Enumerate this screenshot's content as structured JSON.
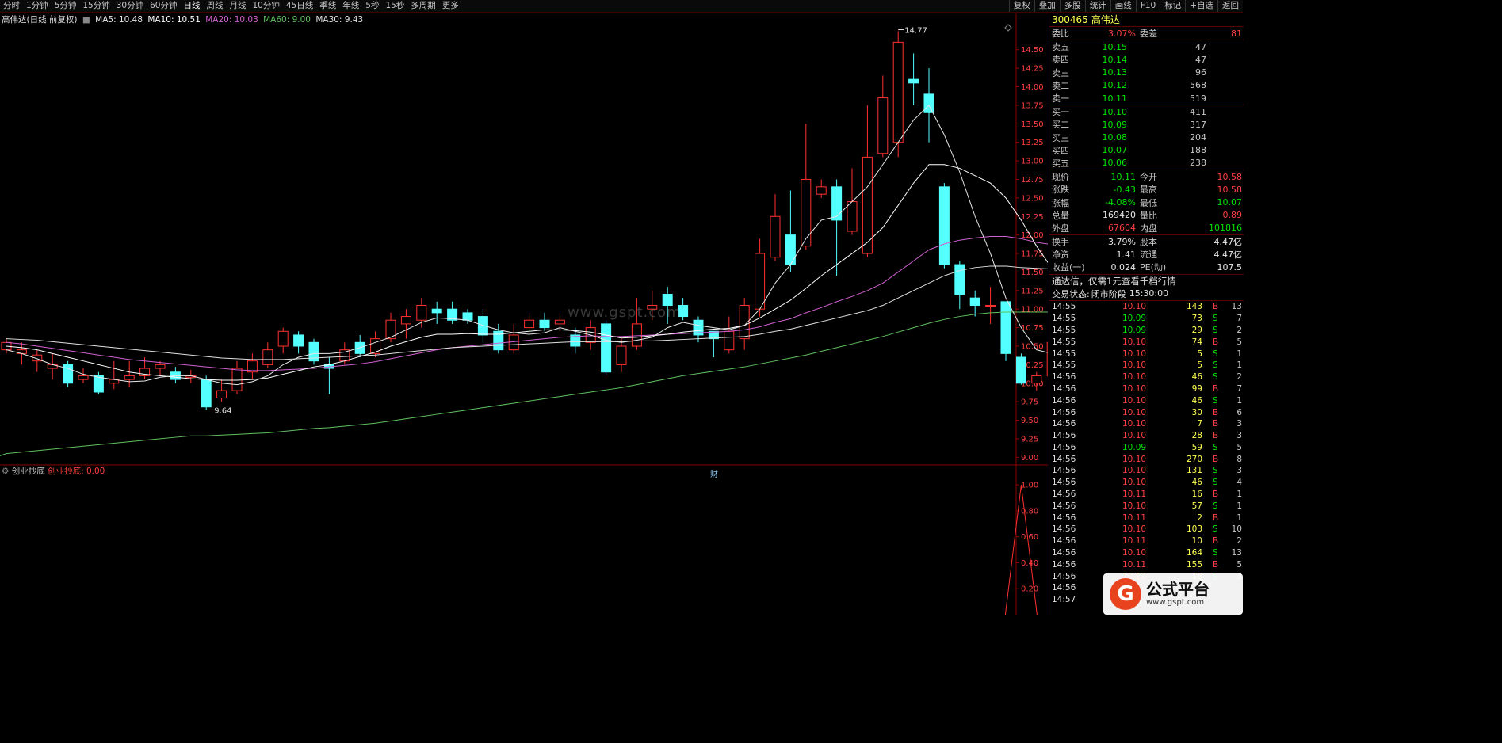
{
  "toolbar": {
    "periods": [
      "分时",
      "1分钟",
      "5分钟",
      "15分钟",
      "30分钟",
      "60分钟",
      "日线",
      "周线",
      "月线",
      "10分钟",
      "45日线",
      "季线",
      "年线",
      "5秒",
      "15秒",
      "多周期",
      "更多"
    ],
    "active_period": "日线",
    "tools": [
      "复权",
      "叠加",
      "多股",
      "统计",
      "画线",
      "F10",
      "标记",
      "+自选",
      "返回"
    ]
  },
  "legend": {
    "name": "高伟达(日线 前复权)",
    "ma5": "MA5: 10.48",
    "ma10": "MA10: 10.51",
    "ma20": "MA20: 10.03",
    "ma60": "MA60: 9.00",
    "ma30": "MA30: 9.43"
  },
  "indicator": {
    "name": "创业抄底",
    "value": "创业抄底: 0.00"
  },
  "watermark": "www.gspt.com",
  "marker_cai": "财",
  "colors": {
    "up": "#ff3030",
    "down": "#54ffff",
    "ma5": "#e8e8e8",
    "ma10": "#ffffff",
    "ma20": "#d060d0",
    "ma30": "#e0e0e0",
    "ma60": "#60c060"
  },
  "chart_data": {
    "type": "candlestick",
    "ylim": [
      8.95,
      14.85
    ],
    "yticks": [
      "14.50",
      "14.25",
      "14.00",
      "13.75",
      "13.50",
      "13.25",
      "13.00",
      "12.75",
      "12.50",
      "12.25",
      "12.00",
      "11.75",
      "11.50",
      "11.25",
      "11.00",
      "10.75",
      "10.50",
      "10.25",
      "10.00",
      "9.75",
      "9.50",
      "9.25",
      "9.00"
    ],
    "annotations": [
      "14.77",
      "9.64"
    ],
    "candles": [
      [
        10.45,
        10.55,
        10.4,
        10.6
      ],
      [
        10.4,
        10.45,
        10.25,
        10.55
      ],
      [
        10.3,
        10.38,
        10.15,
        10.45
      ],
      [
        10.2,
        10.25,
        10.05,
        10.4
      ],
      [
        10.25,
        10.0,
        9.95,
        10.3
      ],
      [
        10.05,
        10.1,
        10.0,
        10.2
      ],
      [
        10.1,
        9.88,
        9.85,
        10.15
      ],
      [
        10.0,
        10.05,
        9.92,
        10.3
      ],
      [
        10.05,
        10.1,
        9.95,
        10.3
      ],
      [
        10.1,
        10.2,
        10.05,
        10.35
      ],
      [
        10.2,
        10.25,
        10.1,
        10.3
      ],
      [
        10.15,
        10.05,
        10.0,
        10.22
      ],
      [
        10.08,
        10.1,
        10.0,
        10.18
      ],
      [
        10.05,
        9.68,
        9.64,
        10.1
      ],
      [
        9.8,
        9.9,
        9.75,
        10.05
      ],
      [
        9.9,
        10.2,
        9.85,
        10.3
      ],
      [
        10.15,
        10.3,
        10.05,
        10.4
      ],
      [
        10.25,
        10.45,
        10.2,
        10.55
      ],
      [
        10.5,
        10.7,
        10.4,
        10.75
      ],
      [
        10.65,
        10.5,
        10.4,
        10.7
      ],
      [
        10.55,
        10.3,
        10.25,
        10.6
      ],
      [
        10.25,
        10.2,
        9.85,
        10.35
      ],
      [
        10.3,
        10.45,
        10.25,
        10.55
      ],
      [
        10.55,
        10.4,
        10.35,
        10.65
      ],
      [
        10.4,
        10.6,
        10.35,
        10.7
      ],
      [
        10.6,
        10.85,
        10.55,
        10.95
      ],
      [
        10.8,
        10.9,
        10.6,
        11.0
      ],
      [
        10.85,
        11.05,
        10.75,
        11.15
      ],
      [
        11.0,
        10.95,
        10.8,
        11.1
      ],
      [
        11.0,
        10.85,
        10.8,
        11.1
      ],
      [
        10.95,
        10.85,
        10.8,
        11.0
      ],
      [
        10.9,
        10.65,
        10.55,
        11.0
      ],
      [
        10.7,
        10.45,
        10.4,
        10.8
      ],
      [
        10.45,
        10.65,
        10.4,
        10.8
      ],
      [
        10.75,
        10.85,
        10.7,
        10.95
      ],
      [
        10.85,
        10.75,
        10.7,
        10.95
      ],
      [
        10.8,
        10.85,
        10.7,
        10.95
      ],
      [
        10.65,
        10.5,
        10.4,
        10.75
      ],
      [
        10.55,
        10.75,
        10.45,
        10.85
      ],
      [
        10.8,
        10.15,
        10.1,
        10.85
      ],
      [
        10.25,
        10.5,
        10.15,
        10.6
      ],
      [
        10.5,
        10.8,
        10.45,
        11.15
      ],
      [
        11.0,
        11.05,
        10.85,
        11.25
      ],
      [
        11.2,
        11.05,
        10.8,
        11.3
      ],
      [
        11.05,
        10.9,
        10.85,
        11.15
      ],
      [
        10.85,
        10.65,
        10.55,
        10.9
      ],
      [
        10.7,
        10.6,
        10.35,
        10.7
      ],
      [
        10.45,
        10.7,
        10.4,
        10.9
      ],
      [
        10.6,
        11.05,
        10.45,
        11.15
      ],
      [
        11.0,
        11.75,
        10.9,
        11.95
      ],
      [
        11.7,
        12.25,
        11.65,
        12.55
      ],
      [
        12.0,
        11.6,
        11.5,
        12.6
      ],
      [
        11.85,
        12.75,
        11.8,
        13.5
      ],
      [
        12.55,
        12.65,
        12.5,
        12.75
      ],
      [
        12.65,
        12.2,
        11.45,
        12.75
      ],
      [
        12.05,
        12.45,
        12.0,
        12.9
      ],
      [
        11.75,
        13.05,
        11.7,
        13.75
      ],
      [
        13.1,
        13.85,
        13.05,
        14.15
      ],
      [
        13.25,
        14.6,
        13.05,
        14.75
      ],
      [
        14.1,
        14.05,
        13.75,
        14.45
      ],
      [
        13.9,
        13.65,
        13.25,
        14.25
      ],
      [
        12.65,
        11.6,
        11.55,
        12.7
      ],
      [
        11.6,
        11.2,
        11.0,
        11.65
      ],
      [
        11.15,
        11.05,
        10.9,
        11.25
      ],
      [
        11.05,
        11.05,
        10.8,
        11.3
      ],
      [
        11.1,
        10.4,
        10.3,
        11.1
      ],
      [
        10.35,
        10.0,
        9.98,
        10.4
      ],
      [
        10.0,
        10.1,
        9.9,
        10.15
      ],
      [
        10.1,
        10.55,
        10.0,
        10.6
      ],
      [
        10.55,
        10.4,
        10.38,
        10.6
      ],
      [
        10.35,
        10.55,
        10.3,
        10.65
      ],
      [
        10.6,
        10.1,
        10.08,
        10.62
      ]
    ],
    "ma5": [
      10.45,
      10.4,
      10.33,
      10.25,
      10.2,
      10.12,
      10.08,
      10.05,
      10.02,
      10.03,
      10.08,
      10.1,
      10.1,
      10.05,
      10.0,
      9.98,
      10.02,
      10.1,
      10.25,
      10.35,
      10.4,
      10.4,
      10.42,
      10.48,
      10.55,
      10.62,
      10.72,
      10.82,
      10.88,
      10.87,
      10.85,
      10.78,
      10.72,
      10.68,
      10.66,
      10.68,
      10.75,
      10.7,
      10.65,
      10.58,
      10.55,
      10.58,
      10.62,
      10.75,
      10.82,
      10.78,
      10.75,
      10.72,
      10.78,
      11.0,
      11.35,
      11.6,
      11.95,
      12.2,
      12.25,
      12.45,
      12.65,
      12.95,
      13.25,
      13.55,
      13.75,
      13.35,
      12.85,
      12.25,
      11.75,
      11.15,
      10.75,
      10.45,
      10.4,
      10.28,
      10.3,
      10.35
    ],
    "ma10": [
      10.5,
      10.48,
      10.45,
      10.4,
      10.35,
      10.3,
      10.25,
      10.2,
      10.15,
      10.12,
      10.1,
      10.08,
      10.06,
      10.05,
      10.04,
      10.04,
      10.05,
      10.07,
      10.12,
      10.17,
      10.22,
      10.25,
      10.3,
      10.36,
      10.42,
      10.5,
      10.56,
      10.62,
      10.66,
      10.66,
      10.67,
      10.66,
      10.66,
      10.68,
      10.7,
      10.72,
      10.72,
      10.71,
      10.69,
      10.65,
      10.61,
      10.62,
      10.64,
      10.66,
      10.69,
      10.71,
      10.73,
      10.74,
      10.78,
      10.88,
      11.0,
      11.12,
      11.28,
      11.45,
      11.6,
      11.75,
      11.9,
      12.1,
      12.4,
      12.7,
      12.95,
      12.95,
      12.9,
      12.8,
      12.7,
      12.5,
      12.2,
      11.85,
      11.55,
      11.25,
      10.9,
      10.7
    ],
    "ma20": [
      10.55,
      10.53,
      10.5,
      10.47,
      10.44,
      10.41,
      10.38,
      10.35,
      10.32,
      10.3,
      10.28,
      10.26,
      10.24,
      10.22,
      10.2,
      10.18,
      10.17,
      10.17,
      10.18,
      10.19,
      10.2,
      10.22,
      10.24,
      10.26,
      10.29,
      10.33,
      10.37,
      10.41,
      10.45,
      10.48,
      10.5,
      10.52,
      10.54,
      10.56,
      10.58,
      10.6,
      10.62,
      10.63,
      10.64,
      10.63,
      10.63,
      10.64,
      10.65,
      10.66,
      10.67,
      10.68,
      10.69,
      10.7,
      10.72,
      10.76,
      10.82,
      10.87,
      10.95,
      11.02,
      11.1,
      11.17,
      11.25,
      11.35,
      11.5,
      11.65,
      11.8,
      11.88,
      11.93,
      11.96,
      11.98,
      11.98,
      11.95,
      11.9,
      11.87,
      11.85,
      11.82,
      11.75
    ],
    "ma30": [
      10.6,
      10.59,
      10.58,
      10.56,
      10.54,
      10.52,
      10.5,
      10.48,
      10.46,
      10.44,
      10.42,
      10.4,
      10.38,
      10.36,
      10.34,
      10.33,
      10.32,
      10.32,
      10.32,
      10.33,
      10.34,
      10.35,
      10.36,
      10.37,
      10.38,
      10.4,
      10.42,
      10.44,
      10.46,
      10.48,
      10.49,
      10.5,
      10.51,
      10.52,
      10.53,
      10.54,
      10.55,
      10.56,
      10.56,
      10.56,
      10.56,
      10.57,
      10.57,
      10.58,
      10.59,
      10.6,
      10.61,
      10.62,
      10.63,
      10.66,
      10.7,
      10.73,
      10.78,
      10.83,
      10.88,
      10.93,
      10.98,
      11.05,
      11.15,
      11.25,
      11.35,
      11.45,
      11.52,
      11.56,
      11.58,
      11.58,
      11.56,
      11.55,
      11.54,
      11.53,
      11.52,
      11.5
    ],
    "ma60": [
      9.05,
      9.07,
      9.09,
      9.11,
      9.13,
      9.15,
      9.17,
      9.19,
      9.21,
      9.23,
      9.25,
      9.27,
      9.29,
      9.29,
      9.3,
      9.31,
      9.32,
      9.33,
      9.35,
      9.37,
      9.39,
      9.4,
      9.42,
      9.44,
      9.46,
      9.49,
      9.52,
      9.55,
      9.58,
      9.61,
      9.64,
      9.67,
      9.7,
      9.73,
      9.76,
      9.79,
      9.82,
      9.85,
      9.88,
      9.91,
      9.94,
      9.98,
      10.02,
      10.06,
      10.1,
      10.13,
      10.16,
      10.19,
      10.22,
      10.26,
      10.3,
      10.34,
      10.38,
      10.43,
      10.48,
      10.53,
      10.58,
      10.63,
      10.69,
      10.75,
      10.81,
      10.86,
      10.9,
      10.93,
      10.95,
      10.96,
      10.96,
      10.96,
      10.96,
      10.96,
      10.96,
      10.95
    ],
    "indicator": {
      "ylim": [
        0,
        1.05
      ],
      "yticks": [
        "1.00",
        "0.80",
        "0.60",
        "0.40",
        "0.20"
      ],
      "peak_index": 66,
      "peak_value": 1.0
    }
  },
  "quote": {
    "code": "300465",
    "name": "高伟达",
    "wb_label": "委比",
    "wb_value": "3.07%",
    "wc_label": "委差",
    "wc_value": "81",
    "asks": [
      {
        "label": "卖五",
        "price": "10.15",
        "vol": "47"
      },
      {
        "label": "卖四",
        "price": "10.14",
        "vol": "47"
      },
      {
        "label": "卖三",
        "price": "10.13",
        "vol": "96"
      },
      {
        "label": "卖二",
        "price": "10.12",
        "vol": "568"
      },
      {
        "label": "卖一",
        "price": "10.11",
        "vol": "519"
      }
    ],
    "bids": [
      {
        "label": "买一",
        "price": "10.10",
        "vol": "411"
      },
      {
        "label": "买二",
        "price": "10.09",
        "vol": "317"
      },
      {
        "label": "买三",
        "price": "10.08",
        "vol": "204"
      },
      {
        "label": "买四",
        "price": "10.07",
        "vol": "188"
      },
      {
        "label": "买五",
        "price": "10.06",
        "vol": "238"
      }
    ],
    "stats": [
      {
        "l1": "现价",
        "v1": "10.11",
        "c1": "green",
        "l2": "今开",
        "v2": "10.58",
        "c2": "red"
      },
      {
        "l1": "涨跌",
        "v1": "-0.43",
        "c1": "green",
        "l2": "最高",
        "v2": "10.58",
        "c2": "red"
      },
      {
        "l1": "涨幅",
        "v1": "-4.08%",
        "c1": "green",
        "l2": "最低",
        "v2": "10.07",
        "c2": "green"
      },
      {
        "l1": "总量",
        "v1": "169420",
        "c1": "white",
        "l2": "量比",
        "v2": "0.89",
        "c2": "red"
      },
      {
        "l1": "外盘",
        "v1": "67604",
        "c1": "red",
        "l2": "内盘",
        "v2": "101816",
        "c2": "green"
      }
    ],
    "fin": [
      {
        "l1": "换手",
        "v1": "3.79%",
        "l2": "股本",
        "v2": "4.47亿"
      },
      {
        "l1": "净资",
        "v1": "1.41",
        "l2": "流通",
        "v2": "4.47亿"
      },
      {
        "l1": "收益(一)",
        "v1": "0.024",
        "l2": "PE(动)",
        "v2": "107.5"
      }
    ],
    "notice": "通达信，仅需1元查看千档行情",
    "trade_status_label": "交易状态:",
    "trade_status_value": "闭市阶段",
    "trade_status_time": "15:30:00"
  },
  "ticks": [
    {
      "t": "14:55",
      "p": "10.10",
      "pc": "red",
      "v": "143",
      "bs": "B",
      "n": "13"
    },
    {
      "t": "14:55",
      "p": "10.09",
      "pc": "green",
      "v": "73",
      "bs": "S",
      "n": "7"
    },
    {
      "t": "14:55",
      "p": "10.09",
      "pc": "green",
      "v": "29",
      "bs": "S",
      "n": "2"
    },
    {
      "t": "14:55",
      "p": "10.10",
      "pc": "red",
      "v": "74",
      "bs": "B",
      "n": "5"
    },
    {
      "t": "14:55",
      "p": "10.10",
      "pc": "red",
      "v": "5",
      "bs": "S",
      "n": "1"
    },
    {
      "t": "14:55",
      "p": "10.10",
      "pc": "red",
      "v": "5",
      "bs": "S",
      "n": "1"
    },
    {
      "t": "14:56",
      "p": "10.10",
      "pc": "red",
      "v": "46",
      "bs": "S",
      "n": "2"
    },
    {
      "t": "14:56",
      "p": "10.10",
      "pc": "red",
      "v": "99",
      "bs": "B",
      "n": "7"
    },
    {
      "t": "14:56",
      "p": "10.10",
      "pc": "red",
      "v": "46",
      "bs": "S",
      "n": "1"
    },
    {
      "t": "14:56",
      "p": "10.10",
      "pc": "red",
      "v": "30",
      "bs": "B",
      "n": "6"
    },
    {
      "t": "14:56",
      "p": "10.10",
      "pc": "red",
      "v": "7",
      "bs": "B",
      "n": "3"
    },
    {
      "t": "14:56",
      "p": "10.10",
      "pc": "red",
      "v": "28",
      "bs": "B",
      "n": "3"
    },
    {
      "t": "14:56",
      "p": "10.09",
      "pc": "green",
      "v": "59",
      "bs": "S",
      "n": "5"
    },
    {
      "t": "14:56",
      "p": "10.10",
      "pc": "red",
      "v": "270",
      "bs": "B",
      "n": "8"
    },
    {
      "t": "14:56",
      "p": "10.10",
      "pc": "red",
      "v": "131",
      "bs": "S",
      "n": "3"
    },
    {
      "t": "14:56",
      "p": "10.10",
      "pc": "red",
      "v": "46",
      "bs": "S",
      "n": "4"
    },
    {
      "t": "14:56",
      "p": "10.11",
      "pc": "red",
      "v": "16",
      "bs": "B",
      "n": "1"
    },
    {
      "t": "14:56",
      "p": "10.10",
      "pc": "red",
      "v": "57",
      "bs": "S",
      "n": "1"
    },
    {
      "t": "14:56",
      "p": "10.11",
      "pc": "red",
      "v": "2",
      "bs": "B",
      "n": "1"
    },
    {
      "t": "14:56",
      "p": "10.10",
      "pc": "red",
      "v": "103",
      "bs": "S",
      "n": "10"
    },
    {
      "t": "14:56",
      "p": "10.11",
      "pc": "red",
      "v": "10",
      "bs": "B",
      "n": "2"
    },
    {
      "t": "14:56",
      "p": "10.10",
      "pc": "red",
      "v": "164",
      "bs": "S",
      "n": "13"
    },
    {
      "t": "14:56",
      "p": "10.11",
      "pc": "red",
      "v": "155",
      "bs": "B",
      "n": "5"
    },
    {
      "t": "14:56",
      "p": "10.11",
      "pc": "red",
      "v": "16",
      "bs": "S",
      "n": "3"
    },
    {
      "t": "14:56",
      "p": "10.11",
      "pc": "red",
      "v": "",
      "bs": "",
      "n": ""
    },
    {
      "t": "14:57",
      "p": "",
      "pc": "red",
      "v": "",
      "bs": "",
      "n": ""
    }
  ],
  "logo": {
    "glyph": "G",
    "name": "公式平台",
    "url": "www.gspt.com"
  }
}
